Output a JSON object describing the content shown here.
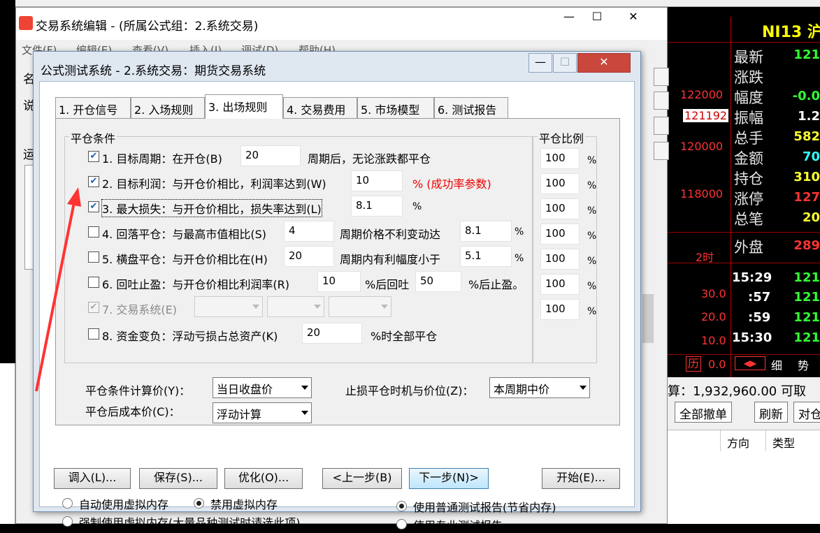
{
  "editor": {
    "title": "交易系统编辑 - (所属公式组：2.系统交易)",
    "menu": [
      "文件(F)",
      "编辑(E)",
      "查看(V)",
      "插入(I)",
      "调试(D)",
      "帮助(H)"
    ],
    "win_min": "—",
    "win_max": "☐",
    "win_close": "✕",
    "left_labels": [
      "名",
      "说",
      "运"
    ]
  },
  "dialog": {
    "title": "公式测试系统 - 2.系统交易：期货交易系统",
    "win_min": "—",
    "win_max": "☐",
    "win_close": "✕",
    "tabs": [
      "1. 开仓信号",
      "2. 入场规则",
      "3. 出场规则",
      "4. 交易费用",
      "5. 市场模型",
      "6. 测试报告"
    ],
    "active_tab": 2,
    "group_title": "平仓条件",
    "ratio_title": "平仓比例",
    "rules": [
      {
        "checked": true,
        "enabled": true,
        "label": "1. 目标周期：在开仓(B)",
        "value": "20",
        "suffix": "周期后，无论涨跌都平仓",
        "ratio": "100"
      },
      {
        "checked": true,
        "enabled": true,
        "label": "2. 目标利润：与开仓价相比，利润率达到(W)",
        "value": "10",
        "suffix": "% (成功率参数)",
        "ratio": "100"
      },
      {
        "checked": true,
        "enabled": true,
        "label": "3. 最大损失：与开仓价相比，损失率达到(L)",
        "value": "8.1",
        "suffix": "%",
        "ratio": "100"
      },
      {
        "checked": false,
        "enabled": true,
        "label": "4. 回落平仓：与最高市值相比(S)",
        "value": "4",
        "suffix": "周期价格不利变动达",
        "value2": "8.1",
        "suffix2": "%",
        "ratio": "100"
      },
      {
        "checked": false,
        "enabled": true,
        "label": "5. 横盘平仓：与开仓价相比在(H)",
        "value": "20",
        "suffix": "周期内有利幅度小于",
        "value2": "5.1",
        "suffix2": "%",
        "ratio": "100"
      },
      {
        "checked": false,
        "enabled": true,
        "label": "6. 回吐止盈：与开仓价相比利润率(R)",
        "value": "10",
        "suffix": "%后回吐",
        "value2": "50",
        "suffix2": "%后止盈。",
        "ratio": "100"
      },
      {
        "checked": true,
        "enabled": false,
        "label": "7. 交易系统(E)",
        "ratio": "100"
      },
      {
        "checked": false,
        "enabled": true,
        "label": "8. 资金变负：浮动亏损占总资产(K)",
        "value": "20",
        "suffix": "%时全部平仓"
      }
    ],
    "pct_sign": "%",
    "calc_price_label": "平仓条件计算价(Y)：",
    "calc_price_value": "当日收盘价",
    "stop_timing_label": "止损平仓时机与价位(Z)：",
    "stop_timing_value": "本周期中价",
    "cost_price_label": "平仓后成本价(C)：",
    "cost_price_value": "浮动计算",
    "buttons": {
      "load": "调入(L)...",
      "save": "保存(S)...",
      "optimize": "优化(O)...",
      "prev": "<上一步(B)",
      "next": "下一步(N)>",
      "start": "开始(E)..."
    },
    "memory_options": [
      {
        "label": "自动使用虚拟内存",
        "selected": false
      },
      {
        "label": "禁用虚拟内存",
        "selected": true
      },
      {
        "label": "强制使用虚拟内存(大量品种测试时请选此项)",
        "selected": false
      }
    ],
    "report_options": [
      {
        "label": "使用普通测试报告(节省内存)",
        "selected": true
      },
      {
        "label": "使用专业测试报告",
        "selected": false
      }
    ]
  },
  "quote": {
    "title": "NI13 沪",
    "rows": [
      {
        "label": "最新",
        "value": "121",
        "color": "green"
      },
      {
        "label": "涨跌",
        "value": "",
        "color": "green"
      },
      {
        "label": "幅度",
        "value": "-0.0",
        "color": "green"
      },
      {
        "label": "振幅",
        "value": "1.2",
        "color": "white"
      },
      {
        "label": "总手",
        "value": "582",
        "color": "yellow"
      },
      {
        "label": "金额",
        "value": "70",
        "color": "cyan"
      },
      {
        "label": "持仓",
        "value": "310",
        "color": "yellow"
      },
      {
        "label": "涨停",
        "value": "127",
        "color": "red"
      },
      {
        "label": "总笔",
        "value": "20",
        "color": "yellow"
      },
      {
        "label": "外盘",
        "value": "289",
        "color": "red"
      }
    ],
    "prices": [
      "122000",
      "121192",
      "120000",
      "118000"
    ],
    "period": "2时",
    "ticks": [
      {
        "time": "15:29",
        "value": "121"
      },
      {
        "time": ":57",
        "value": "121"
      },
      {
        "time": ":59",
        "value": "121"
      },
      {
        "time": "15:30",
        "value": "121"
      }
    ],
    "vol_scale": [
      "30.0",
      "20.0",
      "10.0",
      "0.0"
    ],
    "bottom_tabs": [
      "历",
      "细",
      "势"
    ]
  },
  "account": {
    "summary": "算：1,932,960.00 可取",
    "buttons": [
      "全部撤单",
      "刷新",
      "对仓"
    ],
    "columns": [
      "方向",
      "类型"
    ]
  }
}
